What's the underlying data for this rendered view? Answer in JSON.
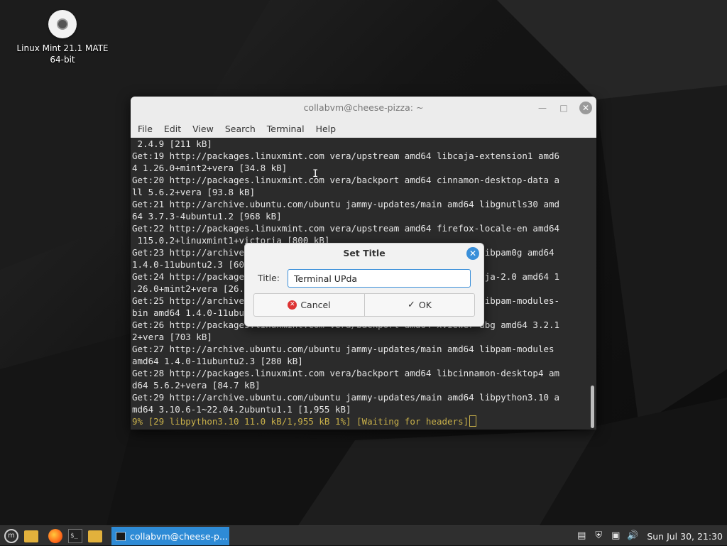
{
  "desktop": {
    "icon_label": "Linux Mint 21.1 MATE 64-bit"
  },
  "terminal": {
    "window_title": "collabvm@cheese-pizza: ~",
    "menu": [
      "File",
      "Edit",
      "View",
      "Search",
      "Terminal",
      "Help"
    ],
    "lines": [
      " 2.4.9 [211 kB]",
      "Get:19 http://packages.linuxmint.com vera/upstream amd64 libcaja-extension1 amd6",
      "4 1.26.0+mint2+vera [34.8 kB]",
      "Get:20 http://packages.linuxmint.com vera/backport amd64 cinnamon-desktop-data a",
      "ll 5.6.2+vera [93.8 kB]",
      "Get:21 http://archive.ubuntu.com/ubuntu jammy-updates/main amd64 libgnutls30 amd",
      "64 3.7.3-4ubuntu1.2 [968 kB]",
      "Get:22 http://packages.linuxmint.com vera/upstream amd64 firefox-locale-en amd64",
      " 115.0.2+linuxmint1+victoria [800 kB]",
      "Get:23 http://archive.ubuntu.com/ubuntu jammy-updates/main amd64 libpam0g amd64",
      "1.4.0-11ubuntu2.3 [60.3 kB]",
      "Get:24 http://packages.linuxmint.com vera/upstream amd64 gir1.2-caja-2.0 amd64 1",
      ".26.0+mint2+vera [26.2 kB]",
      "Get:25 http://archive.ubuntu.com/ubuntu jammy-updates/main amd64 libpam-modules-",
      "bin amd64 1.4.0-11ubuntu2.3 [37.4 kB]",
      "Get:26 http://packages.linuxmint.com vera/backport amd64 xviewer-dbg amd64 3.2.1",
      "2+vera [703 kB]",
      "Get:27 http://archive.ubuntu.com/ubuntu jammy-updates/main amd64 libpam-modules",
      "amd64 1.4.0-11ubuntu2.3 [280 kB]",
      "Get:28 http://packages.linuxmint.com vera/backport amd64 libcinnamon-desktop4 am",
      "d64 5.6.2+vera [84.7 kB]",
      "Get:29 http://archive.ubuntu.com/ubuntu jammy-updates/main amd64 libpython3.10 a",
      "md64 3.10.6-1~22.04.2ubuntu1.1 [1,955 kB]"
    ],
    "status_line": "9% [29 libpython3.10 11.0 kB/1,955 kB 1%] [Waiting for headers]"
  },
  "dialog": {
    "title": "Set Title",
    "field_label": "Title:",
    "field_value": "Terminal UPda",
    "cancel_label": "Cancel",
    "ok_label": "OK"
  },
  "taskbar": {
    "task_label": "collabvm@cheese-p...",
    "clock": "Sun Jul 30, 21:30"
  },
  "colors": {
    "accent": "#2e8bd6",
    "terminal_bg": "#2b2b2b",
    "status_text": "#c8b04a"
  }
}
